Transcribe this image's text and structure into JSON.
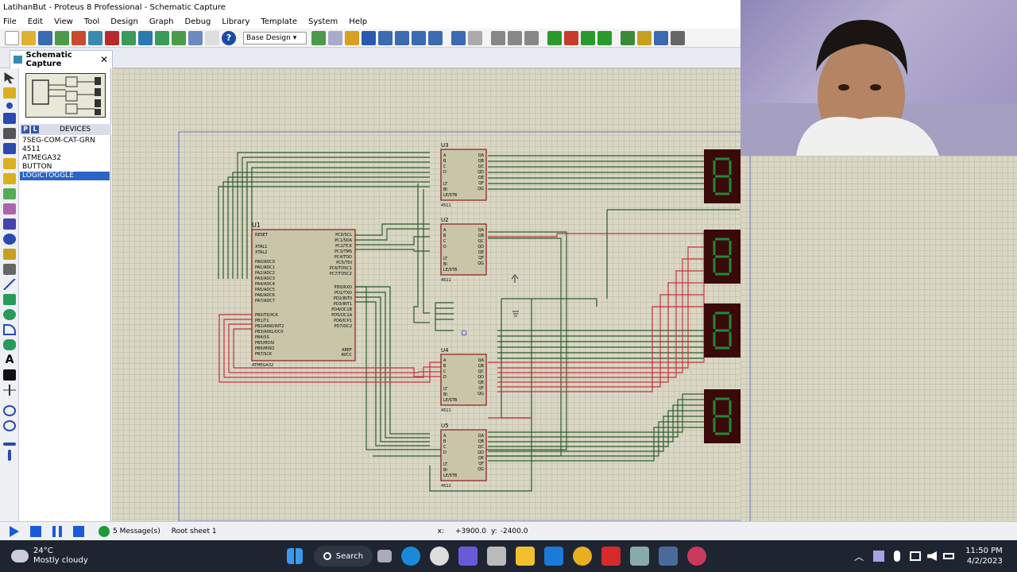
{
  "title": "LatihanBut - Proteus 8 Professional - Schematic Capture",
  "menu": [
    "File",
    "Edit",
    "View",
    "Tool",
    "Design",
    "Graph",
    "Debug",
    "Library",
    "Template",
    "System",
    "Help"
  ],
  "toolbar": {
    "design_select": "Base Design"
  },
  "tab": {
    "label": "Schematic Capture"
  },
  "devices": {
    "header": "DEVICES",
    "p_label": "P",
    "l_label": "L",
    "items": [
      "7SEG-COM-CAT-GRN",
      "4511",
      "ATMEGA32",
      "BUTTON",
      "LOGICTOGGLE"
    ],
    "selected": "LOGICTOGGLE"
  },
  "schematic": {
    "u1_ref": "U1",
    "u1_part": "ATMEGA32",
    "u1_pins_left": [
      "RESET",
      "XTAL1",
      "XTAL2",
      "PA0/ADC0",
      "PA1/ADC1",
      "PA2/ADC2",
      "PA3/ADC3",
      "PA4/ADC4",
      "PA5/ADC5",
      "PA6/ADC6",
      "PA7/ADC7",
      "PB0/T0/XCK",
      "PB1/T1",
      "PB2/AIN0/INT2",
      "PB3/AIN1/OC0",
      "PB4/SS",
      "PB5/MOSI",
      "PB6/MISO",
      "PB7/SCK"
    ],
    "u1_pins_right": [
      "PC0/SCL",
      "PC1/SDA",
      "PC2/TCK",
      "PC3/TMS",
      "PC4/TDO",
      "PC5/TDI",
      "PC6/TOSC1",
      "PC7/TOSC2",
      "PD0/RXD",
      "PD1/TXD",
      "PD2/INT0",
      "PD3/INT1",
      "PD4/OC1B",
      "PD5/OC1A",
      "PD6/ICP1",
      "PD7/OC2",
      "AREF",
      "AVCC"
    ],
    "decoders": [
      {
        "ref": "U3",
        "part": "4511"
      },
      {
        "ref": "U2",
        "part": "4511"
      },
      {
        "ref": "U4",
        "part": "4511"
      },
      {
        "ref": "U5",
        "part": "4511"
      }
    ],
    "dec_pins_left": [
      "A",
      "B",
      "C",
      "D",
      "LT",
      "BI",
      "LE/STB"
    ],
    "dec_pins_right": [
      "QA",
      "QB",
      "QC",
      "QD",
      "QE",
      "QF",
      "QG"
    ]
  },
  "status": {
    "messages": "5 Message(s)",
    "sheet": "Root sheet 1",
    "x_label": "x:",
    "x_val": "+3900.0",
    "y_label": "y:",
    "y_val": "-2400.0"
  },
  "taskbar": {
    "temp": "24°C",
    "weather": "Mostly cloudy",
    "search": "Search",
    "time": "11:50 PM",
    "date": "4/2/2023"
  },
  "colors": {
    "wire_green": "#2b5e2b",
    "wire_red": "#c8323c",
    "chip_fill": "#c9c5a8",
    "chip_border": "#8b1a1a",
    "seg_bg": "#3a0a0a",
    "seg_on": "#1e8a3a"
  }
}
